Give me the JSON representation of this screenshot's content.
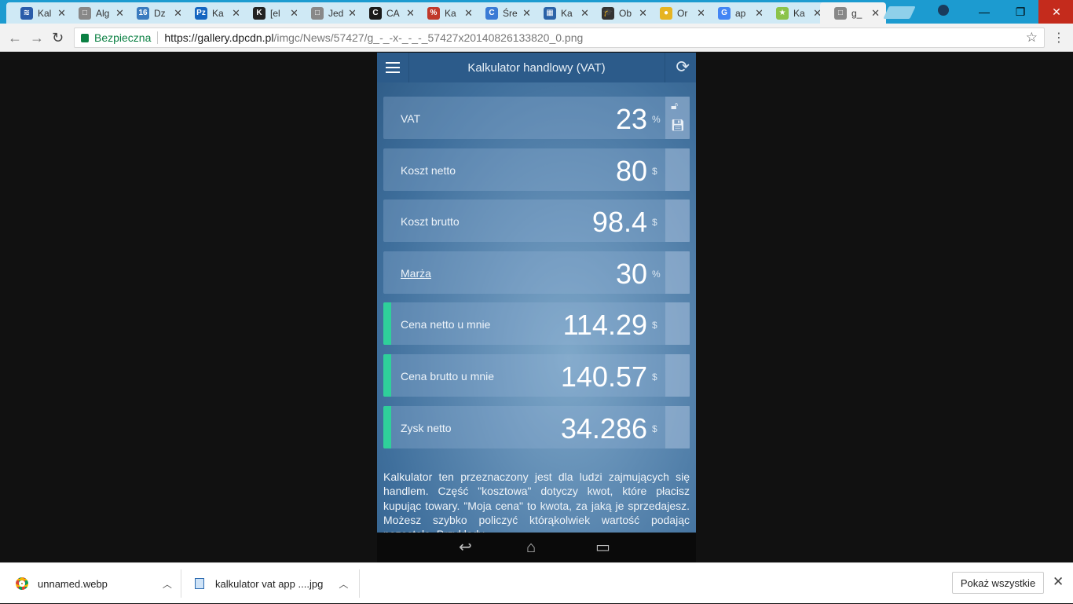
{
  "tabs": [
    {
      "title": "Kal",
      "fav": "≋",
      "color": "#2a5caa"
    },
    {
      "title": "Alg",
      "fav": "□",
      "color": "#888888"
    },
    {
      "title": "Dz",
      "fav": "16",
      "color": "#3b7bbf"
    },
    {
      "title": "Ka",
      "fav": "Pz",
      "color": "#1565c0"
    },
    {
      "title": "[el",
      "fav": "K",
      "color": "#222222"
    },
    {
      "title": "Jed",
      "fav": "□",
      "color": "#888888"
    },
    {
      "title": "CA",
      "fav": "C",
      "color": "#1a1a1a"
    },
    {
      "title": "Ka",
      "fav": "%",
      "color": "#c0392b"
    },
    {
      "title": "Śre",
      "fav": "C",
      "color": "#3a7bd5"
    },
    {
      "title": "Ka",
      "fav": "▦",
      "color": "#2b63a8"
    },
    {
      "title": "Ob",
      "fav": "🎓",
      "color": "#333333"
    },
    {
      "title": "Or",
      "fav": "●",
      "color": "#e6b422"
    },
    {
      "title": "ap",
      "fav": "G",
      "color": "#4285f4"
    },
    {
      "title": "Ka",
      "fav": "★",
      "color": "#8bc34a"
    },
    {
      "title": "g_",
      "fav": "□",
      "color": "#888888"
    }
  ],
  "toolbar": {
    "secure_label": "Bezpieczna",
    "url_host": "https://gallery.dpcdn.pl",
    "url_path": "/imgc/News/57427/g_-_-x-_-_-_57427x20140826133820_0.png"
  },
  "app": {
    "title": "Kalkulator handlowy (VAT)",
    "rows": [
      {
        "label": "VAT",
        "value": "23",
        "unit": "%",
        "accent": false,
        "underline": false
      },
      {
        "label": "Koszt netto",
        "value": "80",
        "unit": "$",
        "accent": false,
        "underline": false
      },
      {
        "label": "Koszt brutto",
        "value": "98.4",
        "unit": "$",
        "accent": false,
        "underline": false
      },
      {
        "label": "Marża",
        "value": "30",
        "unit": "%",
        "accent": false,
        "underline": true
      },
      {
        "label": "Cena netto u mnie",
        "value": "114.29",
        "unit": "$",
        "accent": true,
        "underline": false
      },
      {
        "label": "Cena brutto u mnie",
        "value": "140.57",
        "unit": "$",
        "accent": true,
        "underline": false
      },
      {
        "label": "Zysk netto",
        "value": "34.286",
        "unit": "$",
        "accent": true,
        "underline": false
      }
    ],
    "description": "Kalkulator ten przeznaczony jest dla ludzi zajmujących się handlem. Część \"kosztowa\" dotyczy kwot, które płacisz kupując towary. \"Moja cena\" to kwota, za jaką je sprzedajesz. Możesz szybko policzyć którąkolwiek wartość podając pozostałe. Przykłady"
  },
  "downloads": {
    "items": [
      {
        "name": "unnamed.webp",
        "icon": "chrome-icon"
      },
      {
        "name": "kalkulator vat app ....jpg",
        "icon": "image-file-icon"
      }
    ],
    "show_all": "Pokaż wszystkie"
  }
}
